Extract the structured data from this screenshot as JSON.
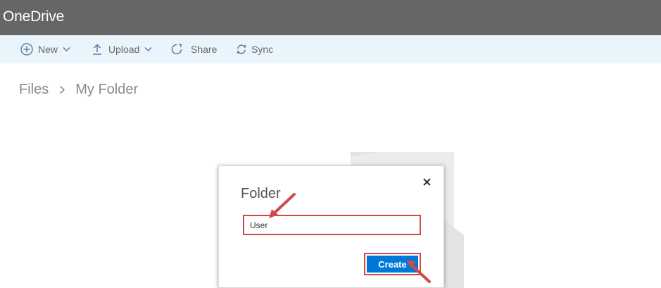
{
  "app": {
    "title": "OneDrive"
  },
  "toolbar": {
    "new_label": "New",
    "upload_label": "Upload",
    "share_label": "Share",
    "sync_label": "Sync"
  },
  "breadcrumb": {
    "root": "Files",
    "current": "My Folder"
  },
  "dialog": {
    "title": "Folder",
    "name_value": "User",
    "create_label": "Create",
    "close_icon": "close-icon"
  },
  "colors": {
    "appbar": "#666666",
    "cmdbar": "#eaf4fb",
    "accent": "#0078d7",
    "annotation": "#d04a49"
  }
}
